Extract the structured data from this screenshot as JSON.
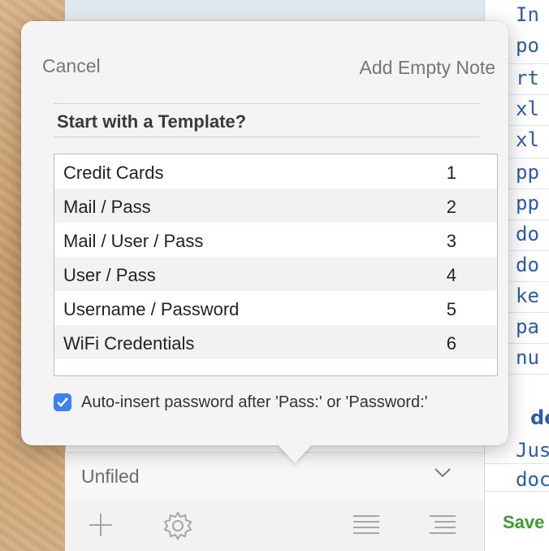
{
  "popover": {
    "cancel_label": "Cancel",
    "empty_note_label": "Add Empty Note",
    "heading": "Start with a Template?",
    "templates": [
      {
        "name": "Credit Cards",
        "shortcut": "1"
      },
      {
        "name": "Mail / Pass",
        "shortcut": "2"
      },
      {
        "name": "Mail / User / Pass",
        "shortcut": "3"
      },
      {
        "name": "User / Pass",
        "shortcut": "4"
      },
      {
        "name": "Username / Password",
        "shortcut": "5"
      },
      {
        "name": "WiFi Credentials",
        "shortcut": "6"
      }
    ],
    "auto_insert": {
      "checked": true,
      "label": "Auto-insert password after 'Pass:' or 'Password:'"
    }
  },
  "sidebar": {
    "folder_label": "Unfiled",
    "folder_chevron": "chevron-down-icon"
  },
  "toolbar": {
    "icons": [
      "plus-icon",
      "gear-icon",
      "list-icon",
      "outline-list-icon"
    ]
  },
  "editor": {
    "lines": [
      "In",
      "po",
      "rt",
      "xl",
      "xl",
      "pp",
      "pp",
      "do",
      "do",
      "ke",
      "pa",
      "nu"
    ],
    "bold_fragment": "de",
    "lines_after": [
      "Jus",
      "doc"
    ],
    "save_label": "Save"
  },
  "colors": {
    "accent_blue": "#3b82f0",
    "editor_text": "#2a5db0",
    "save_green": "#37a02c"
  }
}
